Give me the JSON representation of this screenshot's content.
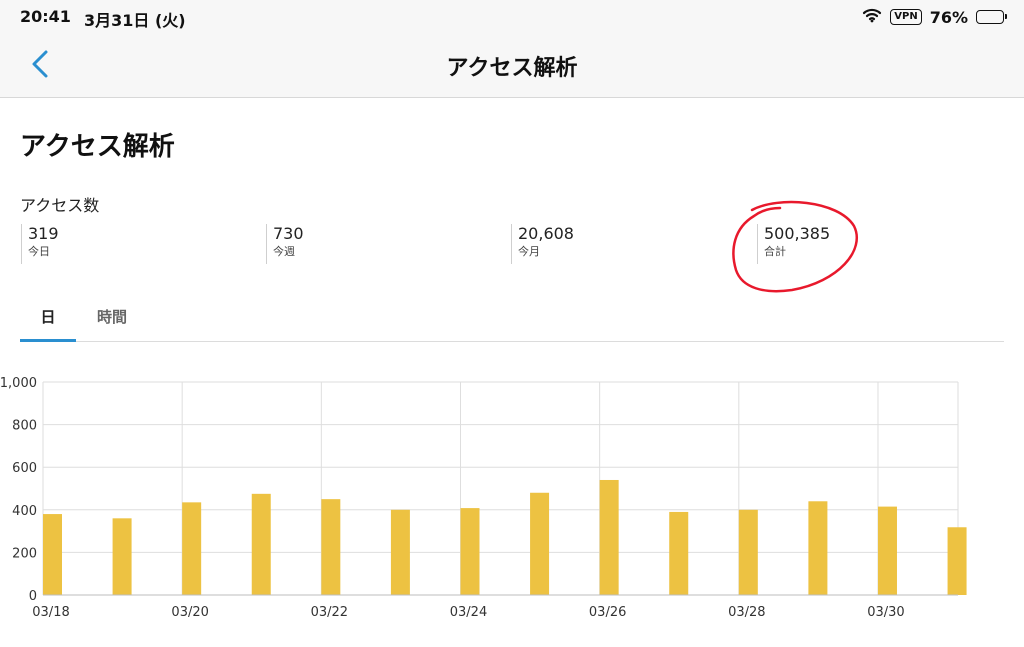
{
  "status_bar": {
    "time": "20:41",
    "date": "3月31日 (火)",
    "vpn": "VPN",
    "battery": "76%",
    "battery_level": 0.76
  },
  "nav": {
    "title": "アクセス解析",
    "back_icon": "chevron-left-icon"
  },
  "page": {
    "title": "アクセス解析",
    "section_label": "アクセス数"
  },
  "stats": [
    {
      "value": "319",
      "label": "今日"
    },
    {
      "value": "730",
      "label": "今週"
    },
    {
      "value": "20,608",
      "label": "今月"
    },
    {
      "value": "500,385",
      "label": "合計"
    }
  ],
  "tabs": [
    {
      "label": "日",
      "active": true
    },
    {
      "label": "時間",
      "active": false
    }
  ],
  "colors": {
    "accent": "#2a8fd0",
    "bar": "#edc242",
    "annotation": "#e8192c"
  },
  "chart_data": {
    "type": "bar",
    "categories": [
      "03/18",
      "03/19",
      "03/20",
      "03/21",
      "03/22",
      "03/23",
      "03/24",
      "03/25",
      "03/26",
      "03/27",
      "03/28",
      "03/29",
      "03/30",
      "03/31"
    ],
    "x_tick_labels": [
      "03/18",
      "03/20",
      "03/22",
      "03/24",
      "03/26",
      "03/28",
      "03/30"
    ],
    "values": [
      380,
      360,
      435,
      475,
      450,
      400,
      408,
      480,
      540,
      390,
      400,
      440,
      415,
      318
    ],
    "y_ticks": [
      "0",
      "200",
      "400",
      "600",
      "800",
      "1,000"
    ],
    "ylim": [
      0,
      1000
    ],
    "grid": true
  }
}
